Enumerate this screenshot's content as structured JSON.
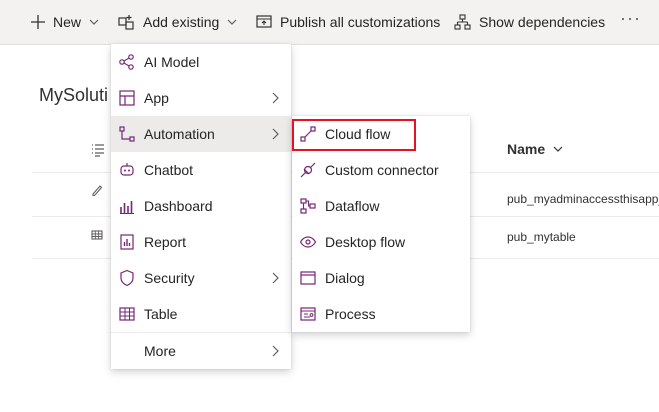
{
  "command_bar": {
    "new_label": "New",
    "add_existing_label": "Add existing",
    "publish_label": "Publish all customizations",
    "dependencies_label": "Show dependencies",
    "more_label": "···"
  },
  "page": {
    "title": "MySoluti",
    "name_column_label": "Name",
    "rows": [
      {
        "name": "pub_myadminaccessthisapp_"
      },
      {
        "name": "pub_mytable"
      }
    ]
  },
  "add_existing_menu": {
    "items": [
      {
        "label": "AI Model",
        "icon": "ai-model-icon"
      },
      {
        "label": "App",
        "icon": "app-icon",
        "submenu": true
      },
      {
        "label": "Automation",
        "icon": "automation-icon",
        "submenu": true,
        "active": true
      },
      {
        "label": "Chatbot",
        "icon": "chatbot-icon"
      },
      {
        "label": "Dashboard",
        "icon": "dashboard-icon"
      },
      {
        "label": "Report",
        "icon": "report-icon"
      },
      {
        "label": "Security",
        "icon": "security-icon",
        "submenu": true
      },
      {
        "label": "Table",
        "icon": "table-icon"
      },
      {
        "label": "More",
        "submenu": true
      }
    ]
  },
  "automation_submenu": {
    "items": [
      {
        "label": "Cloud flow",
        "icon": "cloud-flow-icon",
        "highlighted": true
      },
      {
        "label": "Custom connector",
        "icon": "custom-connector-icon"
      },
      {
        "label": "Dataflow",
        "icon": "dataflow-icon"
      },
      {
        "label": "Desktop flow",
        "icon": "desktop-flow-icon"
      },
      {
        "label": "Dialog",
        "icon": "dialog-icon"
      },
      {
        "label": "Process",
        "icon": "process-icon"
      }
    ]
  },
  "colors": {
    "accent_purple": "#742774",
    "highlight_red": "#e81123",
    "command_bar_bg": "#f3f2f1",
    "active_item_bg": "#edebe9"
  }
}
